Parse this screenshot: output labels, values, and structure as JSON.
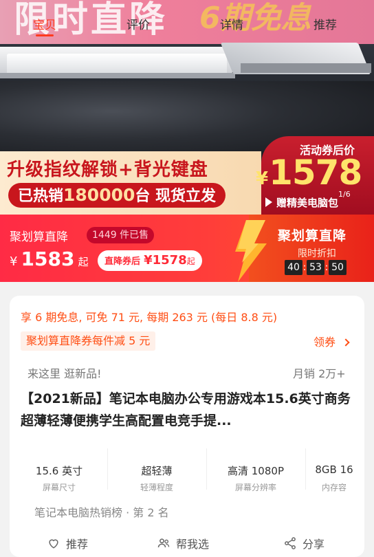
{
  "hero": {
    "title": "限时直降",
    "title_right": "6期免息",
    "promo_line1": "升级指纹解锁+背光键盘",
    "promo_line2_prefix": "已热销",
    "promo_line2_number": "180000",
    "promo_line2_suffix": "台 现货立发",
    "coupon_title": "活动券后价",
    "coupon_currency": "¥",
    "coupon_price": "1578",
    "coupon_gift": "赠精美电脑包",
    "slide_indicator": "1/6"
  },
  "nav": {
    "tabs": [
      {
        "label": "宝贝",
        "active": true
      },
      {
        "label": "评价",
        "active": false
      },
      {
        "label": "详情",
        "active": false
      },
      {
        "label": "推荐",
        "active": false
      }
    ]
  },
  "jhs": {
    "name": "聚划算直降",
    "sold": "1449 件已售",
    "currency": "¥",
    "price": "1583",
    "price_suffix": "起",
    "after_label": "直降券后",
    "after_price": "¥1578",
    "after_suffix": "起",
    "brand": "聚划算直降",
    "limit_text": "限时折扣",
    "countdown": [
      "40",
      "53",
      "50"
    ]
  },
  "card": {
    "installment": "享 6 期免息, 可免 71 元, 每期 263 元 (每日 8.8 元)",
    "coupon_tag": "聚划算直降券每件减 5 元",
    "receive": "领券",
    "sub_left": "来这里 逛新品!",
    "sub_right": "月销 2万+",
    "title": "【2021新品】笔记本电脑办公专用游戏本15.6英寸商务超薄轻薄便携学生高配置电竞手提...",
    "specs": [
      {
        "value": "15.6 英寸",
        "key": "屏幕尺寸"
      },
      {
        "value": "超轻薄",
        "key": "轻薄程度"
      },
      {
        "value": "高清 1080P",
        "key": "屏幕分辨率"
      },
      {
        "value": "8GB 16",
        "key": "内存容"
      }
    ],
    "rank": "笔记本电脑热销榜 · 第 2 名",
    "actions": [
      {
        "label": "推荐",
        "icon": "heart-icon"
      },
      {
        "label": "帮我选",
        "icon": "people-icon"
      },
      {
        "label": "分享",
        "icon": "share-icon"
      }
    ]
  },
  "colors": {
    "accent": "#ff3a1f",
    "jhs_red": "#ff2b45",
    "price_yellow": "#ffe36b",
    "orange_text": "#ff4e14"
  }
}
